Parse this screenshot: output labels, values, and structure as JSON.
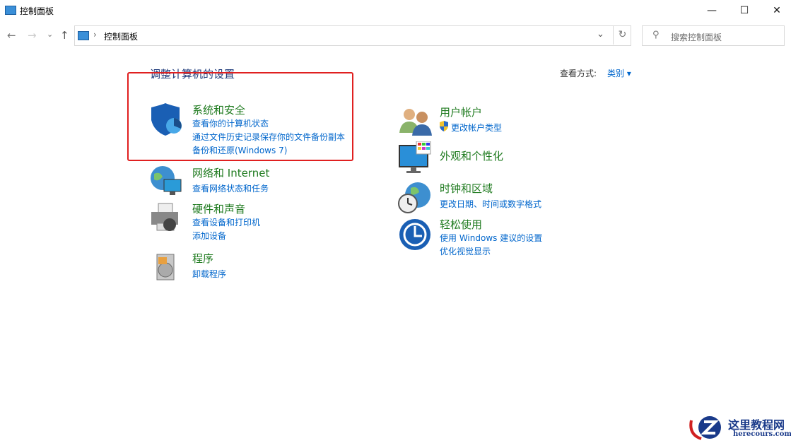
{
  "window": {
    "title": "控制面板",
    "minimize": "—",
    "maximize": "☐",
    "close": "✕"
  },
  "nav": {
    "back": "←",
    "forward": "→",
    "recent": "⌄",
    "up": "↑"
  },
  "address": {
    "separator": "›",
    "path": "控制面板",
    "dropdown": "⌄",
    "refresh": "↻"
  },
  "search": {
    "placeholder": "搜索控制面板",
    "icon": "⚲"
  },
  "heading": "调整计算机的设置",
  "view_by": {
    "label": "查看方式:",
    "value": "类别 ▾"
  },
  "categories": [
    {
      "title": "系统和安全",
      "links": [
        "查看你的计算机状态",
        "通过文件历史记录保存你的文件备份副本",
        "备份和还原(Windows 7)"
      ]
    },
    {
      "title": "网络和 Internet",
      "links": [
        "查看网络状态和任务"
      ]
    },
    {
      "title": "硬件和声音",
      "links": [
        "查看设备和打印机",
        "添加设备"
      ]
    },
    {
      "title": "程序",
      "links": [
        "卸载程序"
      ]
    },
    {
      "title": "用户帐户",
      "links": [
        "更改帐户类型"
      ]
    },
    {
      "title": "外观和个性化",
      "links": []
    },
    {
      "title": "时钟和区域",
      "links": [
        "更改日期、时间或数字格式"
      ]
    },
    {
      "title": "轻松使用",
      "links": [
        "使用 Windows 建议的设置",
        "优化视觉显示"
      ]
    }
  ],
  "watermark": {
    "name": "这里教程网",
    "url": "herecours.com"
  },
  "colors": {
    "link": "#0066cc",
    "category": "#1e7a1e",
    "highlight": "#e02020"
  }
}
